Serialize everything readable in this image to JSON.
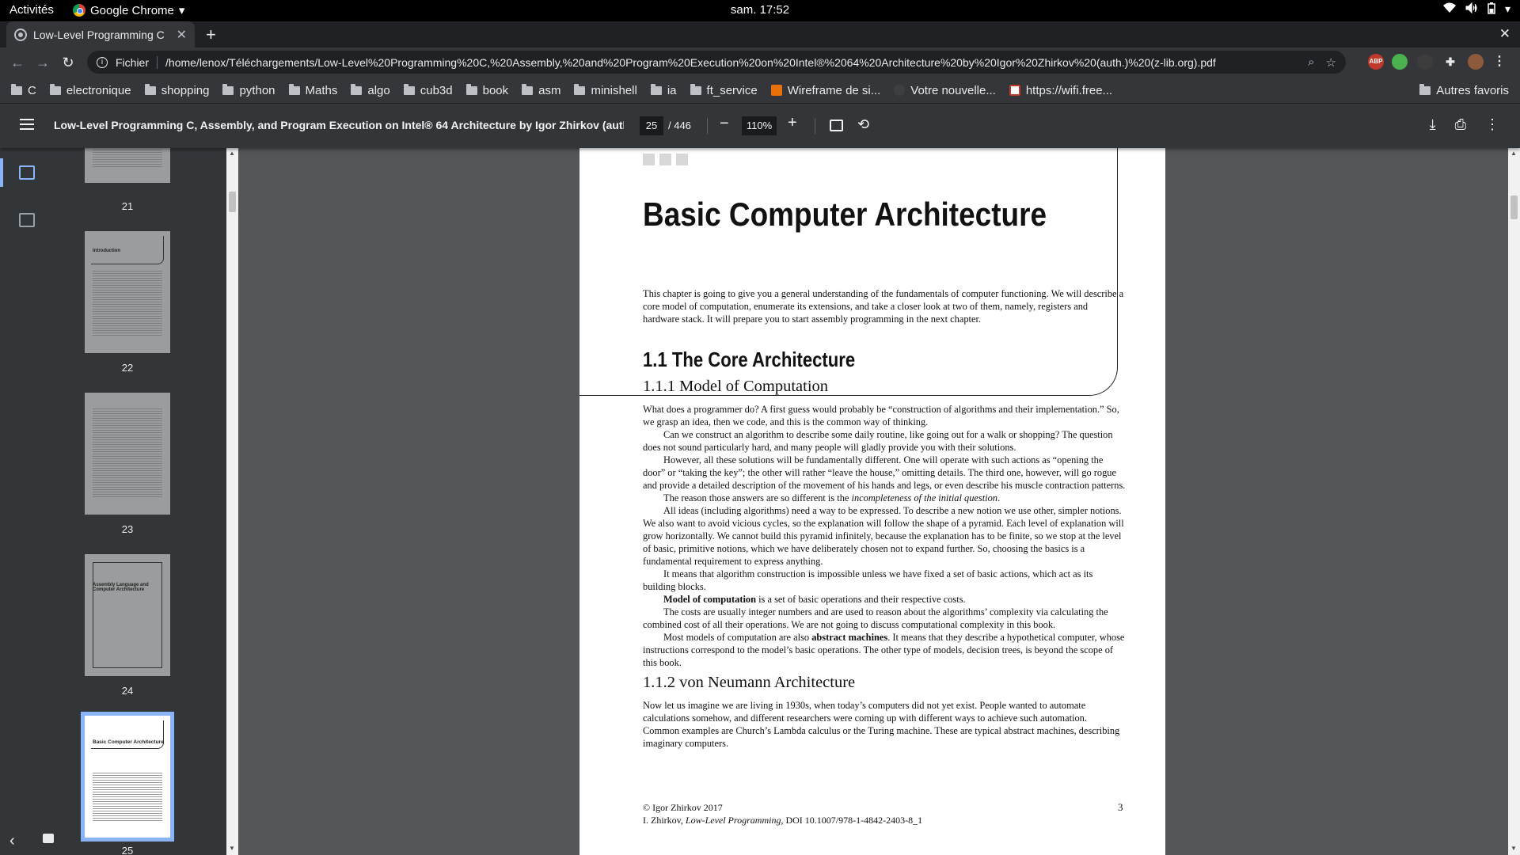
{
  "os": {
    "activities": "Activités",
    "app_name": "Google Chrome",
    "clock": "sam. 17:52"
  },
  "browser": {
    "tab_title": "Low-Level Programming C",
    "url_scheme": "Fichier",
    "url": "/home/lenox/Téléchargements/Low-Level%20Programming%20C,%20Assembly,%20and%20Program%20Execution%20on%20Intel®%2064%20Architecture%20by%20Igor%20Zhirkov%20(auth.)%20(z-lib.org).pdf",
    "bookmarks": [
      "C",
      "electronique",
      "shopping",
      "python",
      "Maths",
      "algo",
      "cub3d",
      "book",
      "asm",
      "minishell",
      "ia",
      "ft_service"
    ],
    "bookmark_links": [
      "Wireframe de si...",
      "Votre nouvelle...",
      "https://wifi.free..."
    ],
    "other_bookmarks": "Autres favoris",
    "ext_colors": {
      "abp": "#c0392b",
      "green": "#4caf50",
      "dark": "#3c3c3c"
    }
  },
  "pdf_toolbar": {
    "title": "Low-Level Programming C, Assembly, and Program Execution on Intel® 64 Architecture by Igor Zhirkov (auth.) (z...",
    "current_page": "25",
    "total_pages": "/ 446",
    "zoom": "110%"
  },
  "thumbnails": {
    "pages": [
      "21",
      "22",
      "23",
      "24",
      "25"
    ],
    "heading_22": "Introduction",
    "heading_24": "Assembly Language and Computer Architecture",
    "heading_25": "Basic Computer Architecture",
    "selected": "25"
  },
  "page": {
    "chapter_title": "Basic Computer Architecture",
    "intro": "This chapter is going to give you a general understanding of the fundamentals of computer functioning. We will describe a core model of computation, enumerate its extensions, and take a closer look at two of them, namely, registers and hardware stack. It will prepare you to start assembly programming in the next chapter.",
    "section_1_1": "1.1    The Core Architecture",
    "section_1_1_1": "1.1.1    Model of Computation",
    "p1": "What does a programmer do? A first guess would probably be “construction of algorithms and their implementation.” So, we grasp an idea, then we code, and this is the common way of thinking.",
    "p2": "Can we construct an algorithm to describe some daily routine, like going out for a walk or shopping? The question does not sound particularly hard, and many people will gladly provide you with their solutions.",
    "p3": "However, all these solutions will be fundamentally different. One will operate with such actions as “opening the door” or “taking the key”; the other will rather “leave the house,” omitting details. The third one, however, will go rogue and provide a detailed description of the movement of his hands and legs, or even describe his muscle contraction patterns.",
    "p4_a": "The reason those answers are so different is the ",
    "p4_em": "incompleteness of the initial question",
    "p4_b": ".",
    "p5": "All ideas (including algorithms) need a way to be expressed. To describe a new notion we use other, simpler notions. We also want to avoid vicious cycles, so the explanation will follow the shape of a pyramid. Each level of explanation will grow horizontally. We cannot build this pyramid infinitely, because the explanation has to be finite, so we stop at the level of basic, primitive notions, which we have deliberately chosen not to expand further. So, choosing the basics is a fundamental requirement to express anything.",
    "p6": "It means that algorithm construction is impossible unless we have fixed a set of basic actions, which act as its building blocks.",
    "p7_strong": "Model of computation",
    "p7_rest": " is a set of basic operations and their respective costs.",
    "p8": "The costs are usually integer numbers and are used to reason about the algorithms’ complexity via calculating the combined cost of all their operations. We are not going to discuss computational complexity in this book.",
    "p9_a": "Most models of computation are also ",
    "p9_strong": "abstract machines",
    "p9_b": ". It means that they describe a hypothetical computer, whose instructions correspond to the model’s basic operations. The other type of models, decision trees, is beyond the scope of this book.",
    "section_1_1_2": "1.1.2    von Neumann Architecture",
    "p10": "Now let us imagine we are living in 1930s, when today’s computers did not yet exist. People wanted to automate calculations somehow, and different researchers were coming up with different ways to achieve such automation. Common examples are Church’s Lambda calculus or the Turing machine. These are typical abstract machines, describing imaginary computers.",
    "footer_copyright": "© Igor Zhirkov 2017",
    "footer_ref_a": "I. Zhirkov, ",
    "footer_ref_em": "Low-Level Programming",
    "footer_ref_b": ", DOI 10.1007/978-1-4842-2403-8_1",
    "page_number": "3"
  }
}
